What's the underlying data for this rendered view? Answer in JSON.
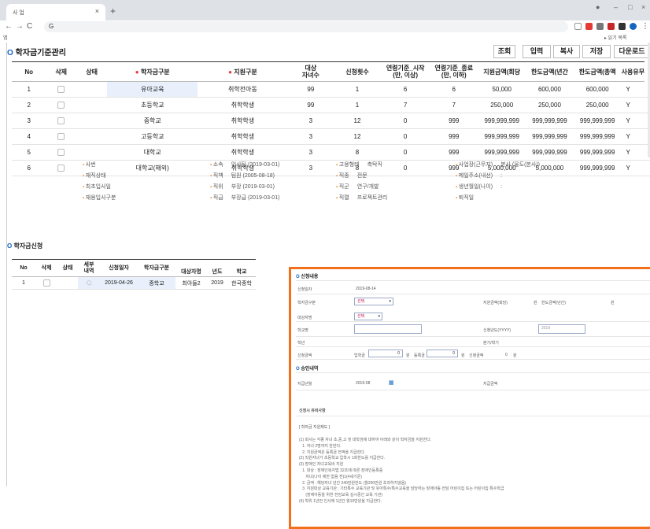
{
  "browser": {
    "tab_title": "사 업",
    "address": "G",
    "bookmark_left": "앱",
    "bookmark_right": "▸ 읽기 목록"
  },
  "page": {
    "title": "학자금기준관리",
    "buttons": [
      "조회",
      "입력",
      "복사",
      "저장",
      "다운로드"
    ]
  },
  "grid": {
    "headers": [
      "No",
      "삭제",
      "상태",
      "학자금구분",
      "지원구분",
      "대상\n자녀수",
      "신청횟수",
      "연령기준_시작\n(만, 이상)",
      "연령기준_종료\n(만, 이하)",
      "지원금액(회당",
      "한도금액(년간",
      "한도금액(총액",
      "사용유무"
    ],
    "rows": [
      [
        "1",
        "",
        "",
        "유아교육",
        "취학전아동",
        "99",
        "1",
        "6",
        "6",
        "50,000",
        "600,000",
        "600,000",
        "Y"
      ],
      [
        "2",
        "",
        "",
        "초등학교",
        "취학학생",
        "99",
        "1",
        "7",
        "7",
        "250,000",
        "250,000",
        "250,000",
        "Y"
      ],
      [
        "3",
        "",
        "",
        "중학교",
        "취학학생",
        "3",
        "12",
        "0",
        "999",
        "999,999,999",
        "999,999,999",
        "999,999,999",
        "Y"
      ],
      [
        "4",
        "",
        "",
        "고등학교",
        "취학학생",
        "3",
        "12",
        "0",
        "999",
        "999,999,999",
        "999,999,999",
        "999,999,999",
        "Y"
      ],
      [
        "5",
        "",
        "",
        "대학교",
        "취학학생",
        "3",
        "8",
        "0",
        "999",
        "999,999,999",
        "999,999,999",
        "999,999,999",
        "Y"
      ],
      [
        "6",
        "",
        "",
        "대학교(해외)",
        "취학학생",
        "3",
        "8",
        "0",
        "999",
        "5,000,000",
        "5,000,000",
        "999,999,999",
        "Y"
      ]
    ]
  },
  "employee_info": {
    "col1": [
      "사번",
      "재직상태",
      "최초입사일",
      "재용입사구분"
    ],
    "col2_labels": [
      "소속",
      "직책",
      "직위",
      "직급"
    ],
    "col2_values": [
      "인사팀 (2019-03-01)",
      "팀원 (2005-08-18)",
      "부장 (2019-03-01)",
      "부장급 (2019-03-01)"
    ],
    "col3_labels": [
      "고용형태",
      "직종",
      "직군",
      "직렬"
    ],
    "col3_values": [
      "촉탁직",
      "전문",
      "연구/개발",
      "프로젝트관리"
    ],
    "col4_labels": [
      "사업장(근무지)",
      "메일주소(내선)",
      "생년월일(나이)",
      "퇴직일"
    ],
    "col4_values": [
      "본사 (울도(본사))",
      ":",
      ":",
      ""
    ]
  },
  "application": {
    "title": "학자금신청",
    "headers": [
      "No",
      "삭제",
      "상태",
      "세부\n내역",
      "신청일자",
      "학자금구분",
      "대상자명",
      "년도",
      "학교"
    ],
    "rows": [
      [
        "1",
        "",
        "",
        "",
        "2019-04-26",
        "중학교",
        "최아들2",
        "2019",
        "한국중학"
      ]
    ]
  },
  "popup": {
    "section1": "신청내용",
    "apply_date_label": "신청일자",
    "apply_date_value": "2019-08-14",
    "type_label": "학자금구분",
    "type_select": "선택",
    "support_amount_label": "지원금액(회당)",
    "won1": "원",
    "limit_label": "한도금액(년간)",
    "won2": "원",
    "target_label": "대상자명",
    "target_select": "선택",
    "school_label": "학교명",
    "year_label": "신청년도(YYYY)",
    "year_value": "2019",
    "grade_label": "학년",
    "term_label": "분기/학기",
    "amount_label": "신청금액",
    "tuition_label": "입학금",
    "tuition_value": "0",
    "won3": "원",
    "fee_label": "등록금",
    "fee_value": "0",
    "won4": "원",
    "total_label": "신청금액",
    "total_value": "0",
    "won5": "원",
    "section2": "승인내역",
    "paymonth_label": "지급년월",
    "paymonth_value": "2019-08",
    "payamount_label": "지급금액",
    "notice_title": "신청시 유의사항",
    "notice_sub": "[ 학자금 지원제도 ]",
    "notice_lines": [
      "(1) 회사는 각종 자녀 초,중,고 및 대학생에 대하여 아래와 같이 학자금을 지원한다.",
      "   1. 자녀 2명까지 한한다.",
      "   2. 지원금액은 등록금 전액을 지급한다.",
      "(2) 직원자녀가 초등학교 입학시 1회한도를 지급한다.",
      "(3) 장애인 자녀교육비 지원",
      "   1. 대상 : 장애인복지법 32조에 따른 장애인등록증",
      "      자녀(나이 제한 없음 전)1(4세기준)",
      "   2. 금액 : 해당자녀 년간 240만원한도 (월200만원 초과하지않음)",
      "   3. 지원대상 교육기관 : 기타특수 교육기관 및 유아특수/특수교육을 담당하는 장애아동 전담 어린이집 또는 어린이집 특수학급",
      "      (장애아동을 위한 전담교육 실시중인 교육 기관)",
      "(4) 학위 1년전 인사에 1년간 월10만원을 지급한다."
    ]
  },
  "colors": {
    "accent": "#f26f1b",
    "brand": "#1565c0",
    "required": "#e53935"
  }
}
